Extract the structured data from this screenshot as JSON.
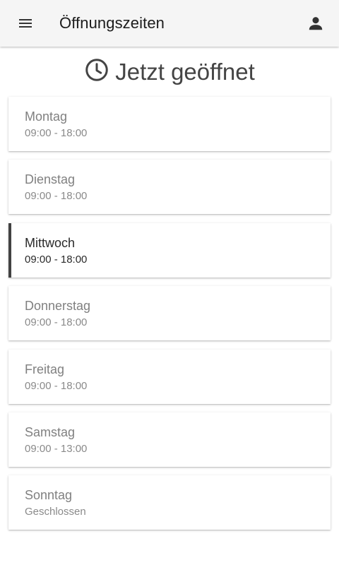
{
  "app_bar": {
    "title": "Öffnungszeiten",
    "menu_icon": "hamburger-menu-icon",
    "account_icon": "account-person-icon"
  },
  "status": {
    "icon": "clock-icon",
    "text": "Jetzt geöffnet"
  },
  "days": [
    {
      "name": "Montag",
      "hours": "09:00 - 18:00",
      "active": false
    },
    {
      "name": "Dienstag",
      "hours": "09:00 - 18:00",
      "active": false
    },
    {
      "name": "Mittwoch",
      "hours": "09:00 - 18:00",
      "active": true
    },
    {
      "name": "Donnerstag",
      "hours": "09:00 - 18:00",
      "active": false
    },
    {
      "name": "Freitag",
      "hours": "09:00 - 18:00",
      "active": false
    },
    {
      "name": "Samstag",
      "hours": "09:00 - 13:00",
      "active": false
    },
    {
      "name": "Sonntag",
      "hours": "Geschlossen",
      "active": false
    }
  ],
  "colors": {
    "app_bar_background": "#f5f5f5",
    "active_indicator": "#424242",
    "inactive_text": "#808080",
    "active_text": "#2a2a2a"
  }
}
